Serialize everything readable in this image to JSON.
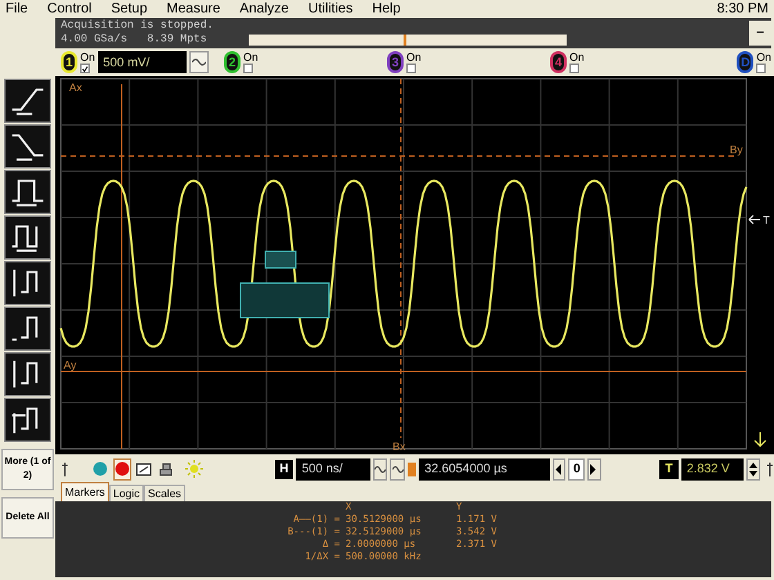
{
  "menu": [
    "File",
    "Control",
    "Setup",
    "Measure",
    "Analyze",
    "Utilities",
    "Help"
  ],
  "clock": "8:30 PM",
  "status": {
    "line1": "Acquisition is stopped.",
    "line2": "4.00 GSa/s   8.39 Mpts",
    "minimize": "–"
  },
  "channels": [
    {
      "number": "1",
      "on_label": "On",
      "on": true,
      "color": "#e8e830",
      "scale": "500 mV/"
    },
    {
      "number": "2",
      "on_label": "On",
      "on": false,
      "color": "#30c030"
    },
    {
      "number": "3",
      "on_label": "On",
      "on": false,
      "color": "#8040c0"
    },
    {
      "number": "4",
      "on_label": "On",
      "on": false,
      "color": "#d03060"
    },
    {
      "number": "D",
      "on_label": "On",
      "on": false,
      "color": "#2050c0"
    }
  ],
  "side_buttons": [
    {
      "label": "More (1 of 2)"
    },
    {
      "label": "Delete All"
    }
  ],
  "plot": {
    "labels": {
      "ax": "Ax",
      "bx": "Bx",
      "ay": "Ay",
      "by": "By",
      "trigger": "T"
    }
  },
  "horizontal": {
    "badge": "H",
    "scale": "500 ns/",
    "delay": "32.6054000 µs",
    "step": "0"
  },
  "trigger": {
    "badge": "T",
    "level": "2.832 V"
  },
  "tabs": [
    {
      "label": "Markers",
      "selected": true
    },
    {
      "label": "Logic",
      "selected": false
    },
    {
      "label": "Scales",
      "selected": false
    }
  ],
  "markers": {
    "columns": [
      "X",
      "Y"
    ],
    "rows": [
      {
        "label": "A——(1) =",
        "x": "30.5129000 µs",
        "y": "1.171 V"
      },
      {
        "label": "B---(1) =",
        "x": "32.5129000 µs",
        "y": "3.542 V"
      },
      {
        "label": "Δ =",
        "x": "2.0000000 µs",
        "y": "2.371 V"
      },
      {
        "label": "1/ΔX =",
        "x": "500.00000 kHz"
      }
    ]
  }
}
